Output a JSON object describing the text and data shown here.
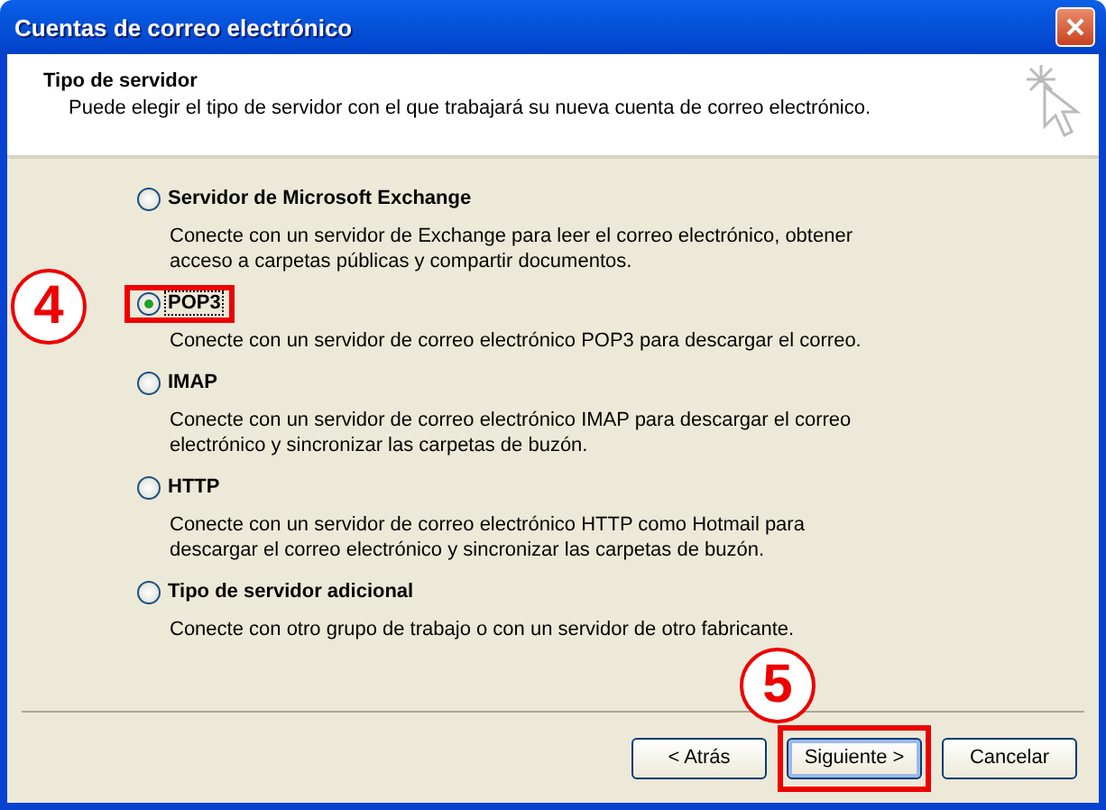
{
  "window": {
    "title": "Cuentas de correo electrónico"
  },
  "header": {
    "title": "Tipo de servidor",
    "subtitle": "Puede elegir el tipo de servidor con el que trabajará su nueva cuenta de correo electrónico."
  },
  "options": [
    {
      "label": "Servidor de Microsoft Exchange",
      "description": "Conecte con un servidor de Exchange para leer el correo electrónico, obtener acceso a carpetas públicas y compartir documentos.",
      "selected": false
    },
    {
      "label": "POP3",
      "description": "Conecte con un servidor de correo electrónico POP3 para descargar el correo.",
      "selected": true,
      "step": "4"
    },
    {
      "label": "IMAP",
      "description": "Conecte con un servidor de correo electrónico IMAP para descargar el correo electrónico y sincronizar las carpetas de buzón.",
      "selected": false
    },
    {
      "label": "HTTP",
      "description": "Conecte con un servidor de correo electrónico HTTP como Hotmail para descargar el correo electrónico y sincronizar las carpetas de buzón.",
      "selected": false
    },
    {
      "label": "Tipo de servidor adicional",
      "description": "Conecte con otro grupo de trabajo o con un servidor de otro fabricante.",
      "selected": false
    }
  ],
  "buttons": [
    {
      "label": "< Atrás",
      "default": false
    },
    {
      "label": "Siguiente >",
      "default": true,
      "step": "5"
    },
    {
      "label": "Cancelar",
      "default": false
    }
  ]
}
